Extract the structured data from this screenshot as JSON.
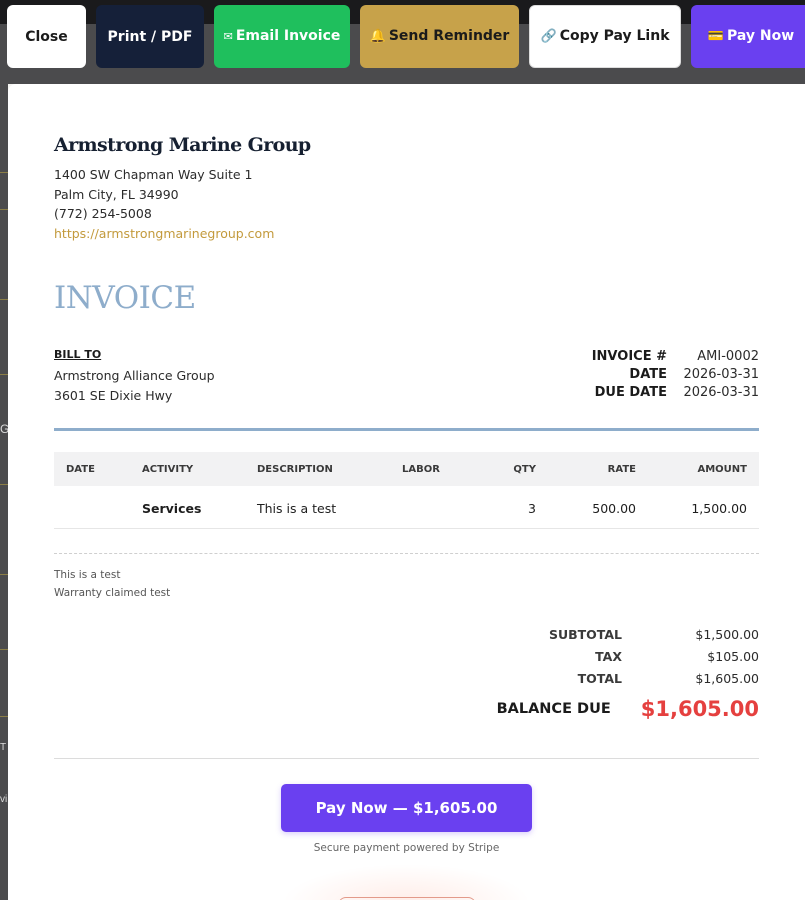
{
  "toolbar": {
    "close_label": "Close",
    "print_label": "Print / PDF",
    "email_icon": "✉",
    "email_label": "Email Invoice",
    "remind_icon": "🔔",
    "remind_label": "Send Reminder",
    "copy_icon": "🔗",
    "copy_label": "Copy Pay Link",
    "pay_icon": "💳",
    "pay_label": "Pay Now"
  },
  "company": {
    "name": "Armstrong Marine Group",
    "address_line1": "1400 SW Chapman Way Suite 1",
    "address_line2": "Palm City, FL 34990",
    "phone": "(772) 254-5008",
    "website": "https://armstrongmarinegroup.com"
  },
  "invoice": {
    "heading": "INVOICE",
    "bill_to_label": "BILL TO",
    "bill_to_name": "Armstrong Alliance Group",
    "bill_to_address": "3601 SE Dixie Hwy",
    "meta": [
      {
        "key": "INVOICE #",
        "value": "AMI-0002"
      },
      {
        "key": "DATE",
        "value": "2026-03-31"
      },
      {
        "key": "DUE DATE",
        "value": "2026-03-31"
      }
    ],
    "columns": {
      "date": "DATE",
      "activity": "ACTIVITY",
      "description": "DESCRIPTION",
      "labor": "LABOR",
      "qty": "QTY",
      "rate": "RATE",
      "amount": "AMOUNT"
    },
    "rows": [
      {
        "date": "",
        "activity": "Services",
        "description": "This is a test",
        "labor": "",
        "qty": "3",
        "rate": "500.00",
        "amount": "1,500.00"
      }
    ],
    "notes": [
      "This is a test",
      "Warranty claimed test"
    ],
    "totals": [
      {
        "key": "SUBTOTAL",
        "value": "$1,500.00"
      },
      {
        "key": "TAX",
        "value": "$105.00"
      },
      {
        "key": "TOTAL",
        "value": "$1,605.00"
      }
    ],
    "balance_due_label": "BALANCE DUE",
    "balance_due_value": "$1,605.00",
    "pay_button_label": "Pay Now — $1,605.00",
    "secure_text": "Secure payment powered by Stripe"
  },
  "background_fragments": [
    "G",
    "T",
    "vi"
  ],
  "colors": {
    "accent_purple": "#6a40f0",
    "email_green": "#1fbf5d",
    "reminder_gold": "#c7a24a",
    "navy": "#152039",
    "invoice_blue": "#8eadcb",
    "balance_red": "#e5403f",
    "link_gold": "#c39a3c"
  }
}
